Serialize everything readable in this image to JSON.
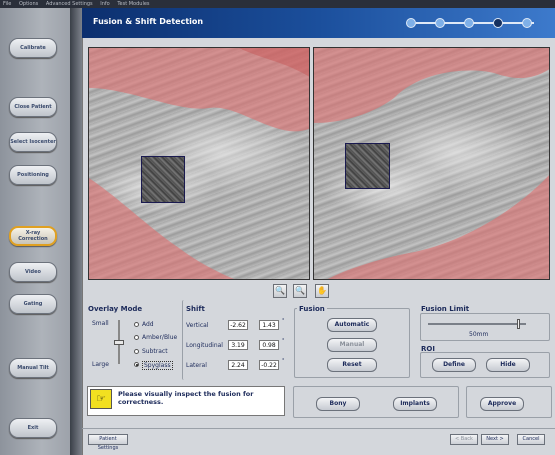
{
  "menu": [
    "File",
    "Options",
    "Advanced Settings",
    "Info",
    "Test Modules"
  ],
  "sidebar": {
    "items": [
      {
        "label": "Calibrate"
      },
      {
        "label": "Close Patient"
      },
      {
        "label": "Select Isocenter"
      },
      {
        "label": "Positioning"
      },
      {
        "label": "X-ray Correction"
      },
      {
        "label": "Video"
      },
      {
        "label": "Gating"
      },
      {
        "label": "Manual Tilt"
      },
      {
        "label": "Exit"
      }
    ],
    "active_index": 4
  },
  "header": {
    "title": "Fusion & Shift Detection"
  },
  "workflow_steps": {
    "total": 5,
    "completed": 4
  },
  "image_tools": [
    "zoom-in-icon",
    "zoom-out-icon",
    "pan-hand-icon"
  ],
  "overlay_mode": {
    "title": "Overlay Mode",
    "size_small": "Small",
    "size_large": "Large",
    "options": [
      "Add",
      "Amber/Blue",
      "Subtract",
      "Spyglass"
    ],
    "selected": "Spyglass"
  },
  "shift": {
    "title": "Shift",
    "rows": [
      {
        "label": "Vertical",
        "v1": "-2.62",
        "v2": "1.43",
        "unit": "°"
      },
      {
        "label": "Longitudinal",
        "v1": "3.19",
        "v2": "0.98",
        "unit": "°"
      },
      {
        "label": "Lateral",
        "v1": "2.24",
        "v2": "-0.22",
        "unit": "°"
      }
    ]
  },
  "fusion": {
    "title": "Fusion",
    "automatic": "Automatic",
    "manual": "Manual",
    "reset": "Reset"
  },
  "fusion_limit": {
    "title": "Fusion Limit",
    "value_label": "50mm",
    "level": 0.92
  },
  "roi": {
    "title": "ROI",
    "define": "Define",
    "hide": "Hide"
  },
  "message": {
    "text": "Please visually inspect the fusion for correctness.",
    "icon": "pointing-hand-icon"
  },
  "view_mode": {
    "bony": "Bony",
    "implants": "Implants"
  },
  "approve_label": "Approve",
  "footer": {
    "patient_settings": "Patient Settings",
    "back": "< Back",
    "next": "Next >",
    "cancel": "Cancel"
  },
  "colors": {
    "title_bar": "#1b4f9c",
    "overlay_red": "#e07070",
    "active_border": "#e0a020",
    "message_icon_bg": "#f2e020"
  }
}
